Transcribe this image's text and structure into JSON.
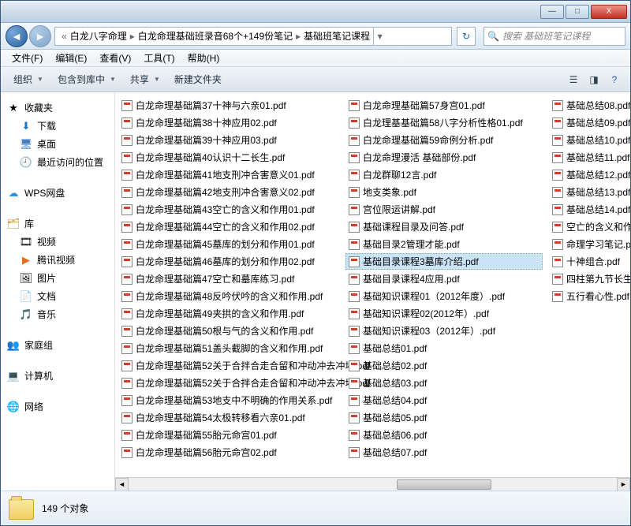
{
  "titlebar": {
    "min": "—",
    "max": "□",
    "close": "X"
  },
  "nav": {
    "back": "◄",
    "fwd": "►",
    "bc_prefix": "«",
    "bc1": "白龙八字命理",
    "bc2": "白龙命理基础班录音68个+149份笔记",
    "bc3": "基础班笔记课程",
    "refresh": "↻",
    "search_placeholder": "搜索 基础班笔记课程"
  },
  "menu": {
    "file": "文件(F)",
    "edit": "编辑(E)",
    "view": "查看(V)",
    "tools": "工具(T)",
    "help": "帮助(H)"
  },
  "toolbar": {
    "organize": "组织",
    "include": "包含到库中",
    "share": "共享",
    "newfolder": "新建文件夹"
  },
  "sidebar": {
    "favorites": "收藏夹",
    "downloads": "下载",
    "desktop": "桌面",
    "recent": "最近访问的位置",
    "wps": "WPS网盘",
    "libraries": "库",
    "videos": "视频",
    "txvideo": "腾讯视频",
    "pictures": "图片",
    "documents": "文档",
    "music": "音乐",
    "homegroup": "家庭组",
    "computer": "计算机",
    "network": "网络"
  },
  "files_col1": [
    "白龙命理基础篇37十神与六亲01.pdf",
    "白龙命理基础篇38十神应用02.pdf",
    "白龙命理基础篇39十神应用03.pdf",
    "白龙命理基础篇40认识十二长生.pdf",
    "白龙命理基础篇41地支刑冲合害意义01.pdf",
    "白龙命理基础篇42地支刑冲合害意义02.pdf",
    "白龙命理基础篇43空亡的含义和作用01.pdf",
    "白龙命理基础篇44空亡的含义和作用02.pdf",
    "白龙命理基础篇45墓库的划分和作用01.pdf",
    "白龙命理基础篇46墓库的划分和作用02.pdf",
    "白龙命理基础篇47空亡和墓库练习.pdf",
    "白龙命理基础篇48反吟伏吟的含义和作用.pdf",
    "白龙命理基础篇49夹拱的含义和作用.pdf",
    "白龙命理基础篇50根与气的含义和作用.pdf",
    "白龙命理基础篇51盖头截脚的含义和作用.pdf",
    "白龙命理基础篇52关于合拌合走合留和冲动冲去冲坏.pdf",
    "白龙命理基础篇52关于合拌合走合留和冲动冲去冲坏.pdf",
    "白龙命理基础篇53地支中不明确的作用关系.pdf",
    "白龙命理基础篇54太极转移看六亲01.pdf"
  ],
  "files_col2": [
    "白龙命理基础篇55胎元命宫01.pdf",
    "白龙命理基础篇56胎元命宫02.pdf",
    "白龙命理基础篇57身宫01.pdf",
    "白龙理基基础篇58八字分析性格01.pdf",
    "白龙命理基础篇59命例分析.pdf",
    "白龙命理漫活 基础部份.pdf",
    "白龙群聊12言.pdf",
    "地支类象.pdf",
    "宫位限运讲解.pdf",
    "基础课程目录及问答.pdf",
    "基础目录2管理才能.pdf",
    "基础目录课程3墓库介绍.pdf",
    "基础目录课程4应用.pdf",
    "基础知识课程01（2012年度）.pdf",
    "基础知识课程02(2012年）.pdf",
    "基础知识课程03（2012年）.pdf",
    "基础总结01.pdf",
    "基础总结02.pdf",
    "基础总结03.pdf"
  ],
  "files_col3": [
    "基础总结04.pdf",
    "基础总结05.pdf",
    "基础总结06.pdf",
    "基础总结07.pdf",
    "基础总结08.pdf",
    "基础总结09.pdf",
    "基础总结10.pdf",
    "基础总结11.pdf",
    "基础总结12.pdf",
    "基础总结13.pdf",
    "基础总结14.pdf",
    "空亡的含义和作用.pdf",
    "命理学习笔记.pdf",
    "十神组合.pdf",
    "四柱第九节长生应用.pdf",
    "五行看心性.pdf"
  ],
  "selected_index_col2": 11,
  "status": {
    "count": "149 个对象"
  }
}
